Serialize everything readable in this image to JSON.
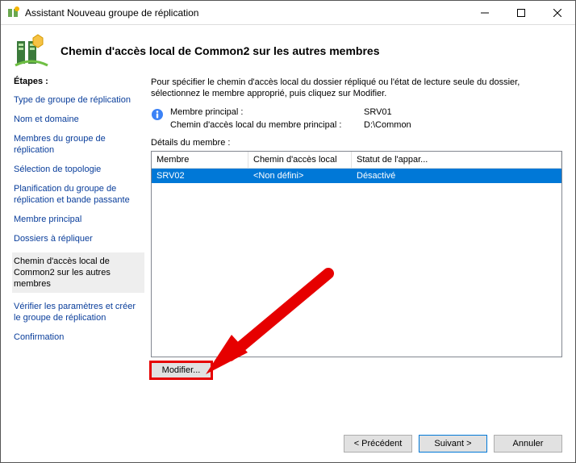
{
  "window": {
    "title": "Assistant Nouveau groupe de réplication"
  },
  "wizard": {
    "heading": "Chemin d'accès local de Common2 sur les autres membres"
  },
  "sidebar": {
    "label": "Étapes :",
    "steps": [
      {
        "label": "Type de groupe de réplication"
      },
      {
        "label": "Nom et domaine"
      },
      {
        "label": "Membres du groupe de réplication"
      },
      {
        "label": "Sélection de topologie"
      },
      {
        "label": "Planification du groupe de réplication et bande passante"
      },
      {
        "label": "Membre principal"
      },
      {
        "label": "Dossiers à répliquer"
      },
      {
        "label": "Chemin d'accès local de Common2 sur les autres membres"
      },
      {
        "label": "Vérifier les paramètres et créer le groupe de réplication"
      },
      {
        "label": "Confirmation"
      }
    ],
    "current_index": 7
  },
  "main": {
    "intro": "Pour spécifier le chemin d'accès local du dossier répliqué ou l'état de lecture seule du dossier, sélectionnez le membre approprié, puis cliquez sur Modifier.",
    "info": {
      "primary_member_label": "Membre principal :",
      "primary_member_value": "SRV01",
      "primary_path_label": "Chemin d'accès local du membre principal :",
      "primary_path_value": "D:\\Common"
    },
    "details_label": "Détails du membre :",
    "grid": {
      "columns": {
        "member": "Membre",
        "path": "Chemin d'accès local",
        "status": "Statut de l'appar..."
      },
      "rows": [
        {
          "member": "SRV02",
          "path": "<Non défini>",
          "status": "Désactivé"
        }
      ]
    },
    "modify_button": "Modifier..."
  },
  "footer": {
    "prev": "< Précédent",
    "next": "Suivant >",
    "cancel": "Annuler"
  }
}
